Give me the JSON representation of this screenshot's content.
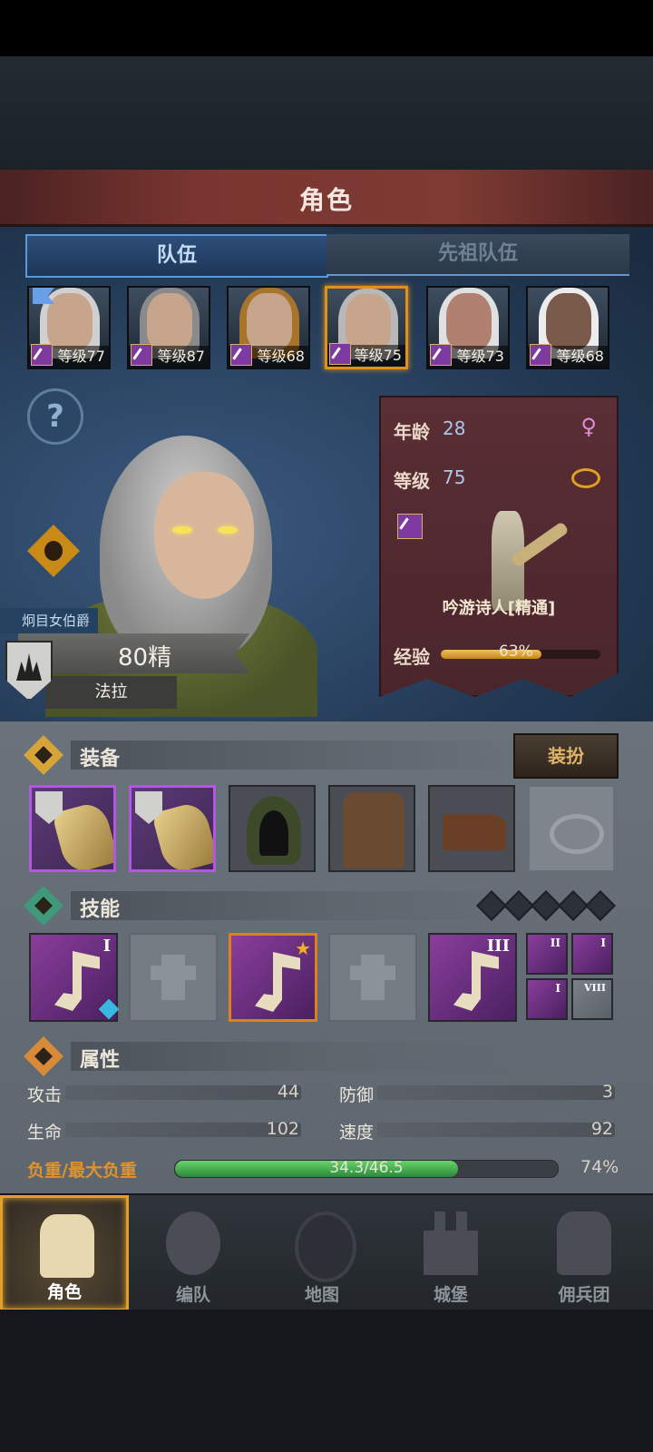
{
  "header": {
    "title": "角色"
  },
  "tabs": [
    {
      "label": "队伍"
    },
    {
      "label": "先祖队伍"
    }
  ],
  "heroes": [
    {
      "level": "等级77"
    },
    {
      "level": "等级87"
    },
    {
      "level": "等级68"
    },
    {
      "level": "等级75"
    },
    {
      "level": "等级73"
    },
    {
      "level": "等级68"
    }
  ],
  "character": {
    "title": "炯目女伯爵",
    "tier": "80精",
    "name": "法拉",
    "age_label": "年龄",
    "age": "28",
    "level_label": "等级",
    "level": "75",
    "class_name": "吟游诗人[精通]",
    "xp_label": "经验",
    "xp_percent": "63%",
    "xp_fraction": 0.63
  },
  "equipment": {
    "label": "装备",
    "dress_button": "装扮"
  },
  "skills": {
    "label": "技能",
    "roman1": "I",
    "gem_count": "4",
    "roman3": "III",
    "mini1": "II",
    "mini2": "I",
    "mini3": "I",
    "mini4": "VIII"
  },
  "attributes": {
    "label": "属性",
    "attack_label": "攻击",
    "attack": "44",
    "defense_label": "防御",
    "defense": "3",
    "hp_label": "生命",
    "hp": "102",
    "speed_label": "速度",
    "speed": "92",
    "load_label": "负重/最大负重",
    "load": "34.3/46.5",
    "load_percent": "74%",
    "load_fraction": 0.74
  },
  "nav": [
    {
      "label": "角色"
    },
    {
      "label": "编队"
    },
    {
      "label": "地图"
    },
    {
      "label": "城堡"
    },
    {
      "label": "佣兵团"
    }
  ],
  "colors": {
    "accent": "#e0a02a",
    "tab_active": "#5d98d6",
    "info_panel": "#5a2e35"
  }
}
